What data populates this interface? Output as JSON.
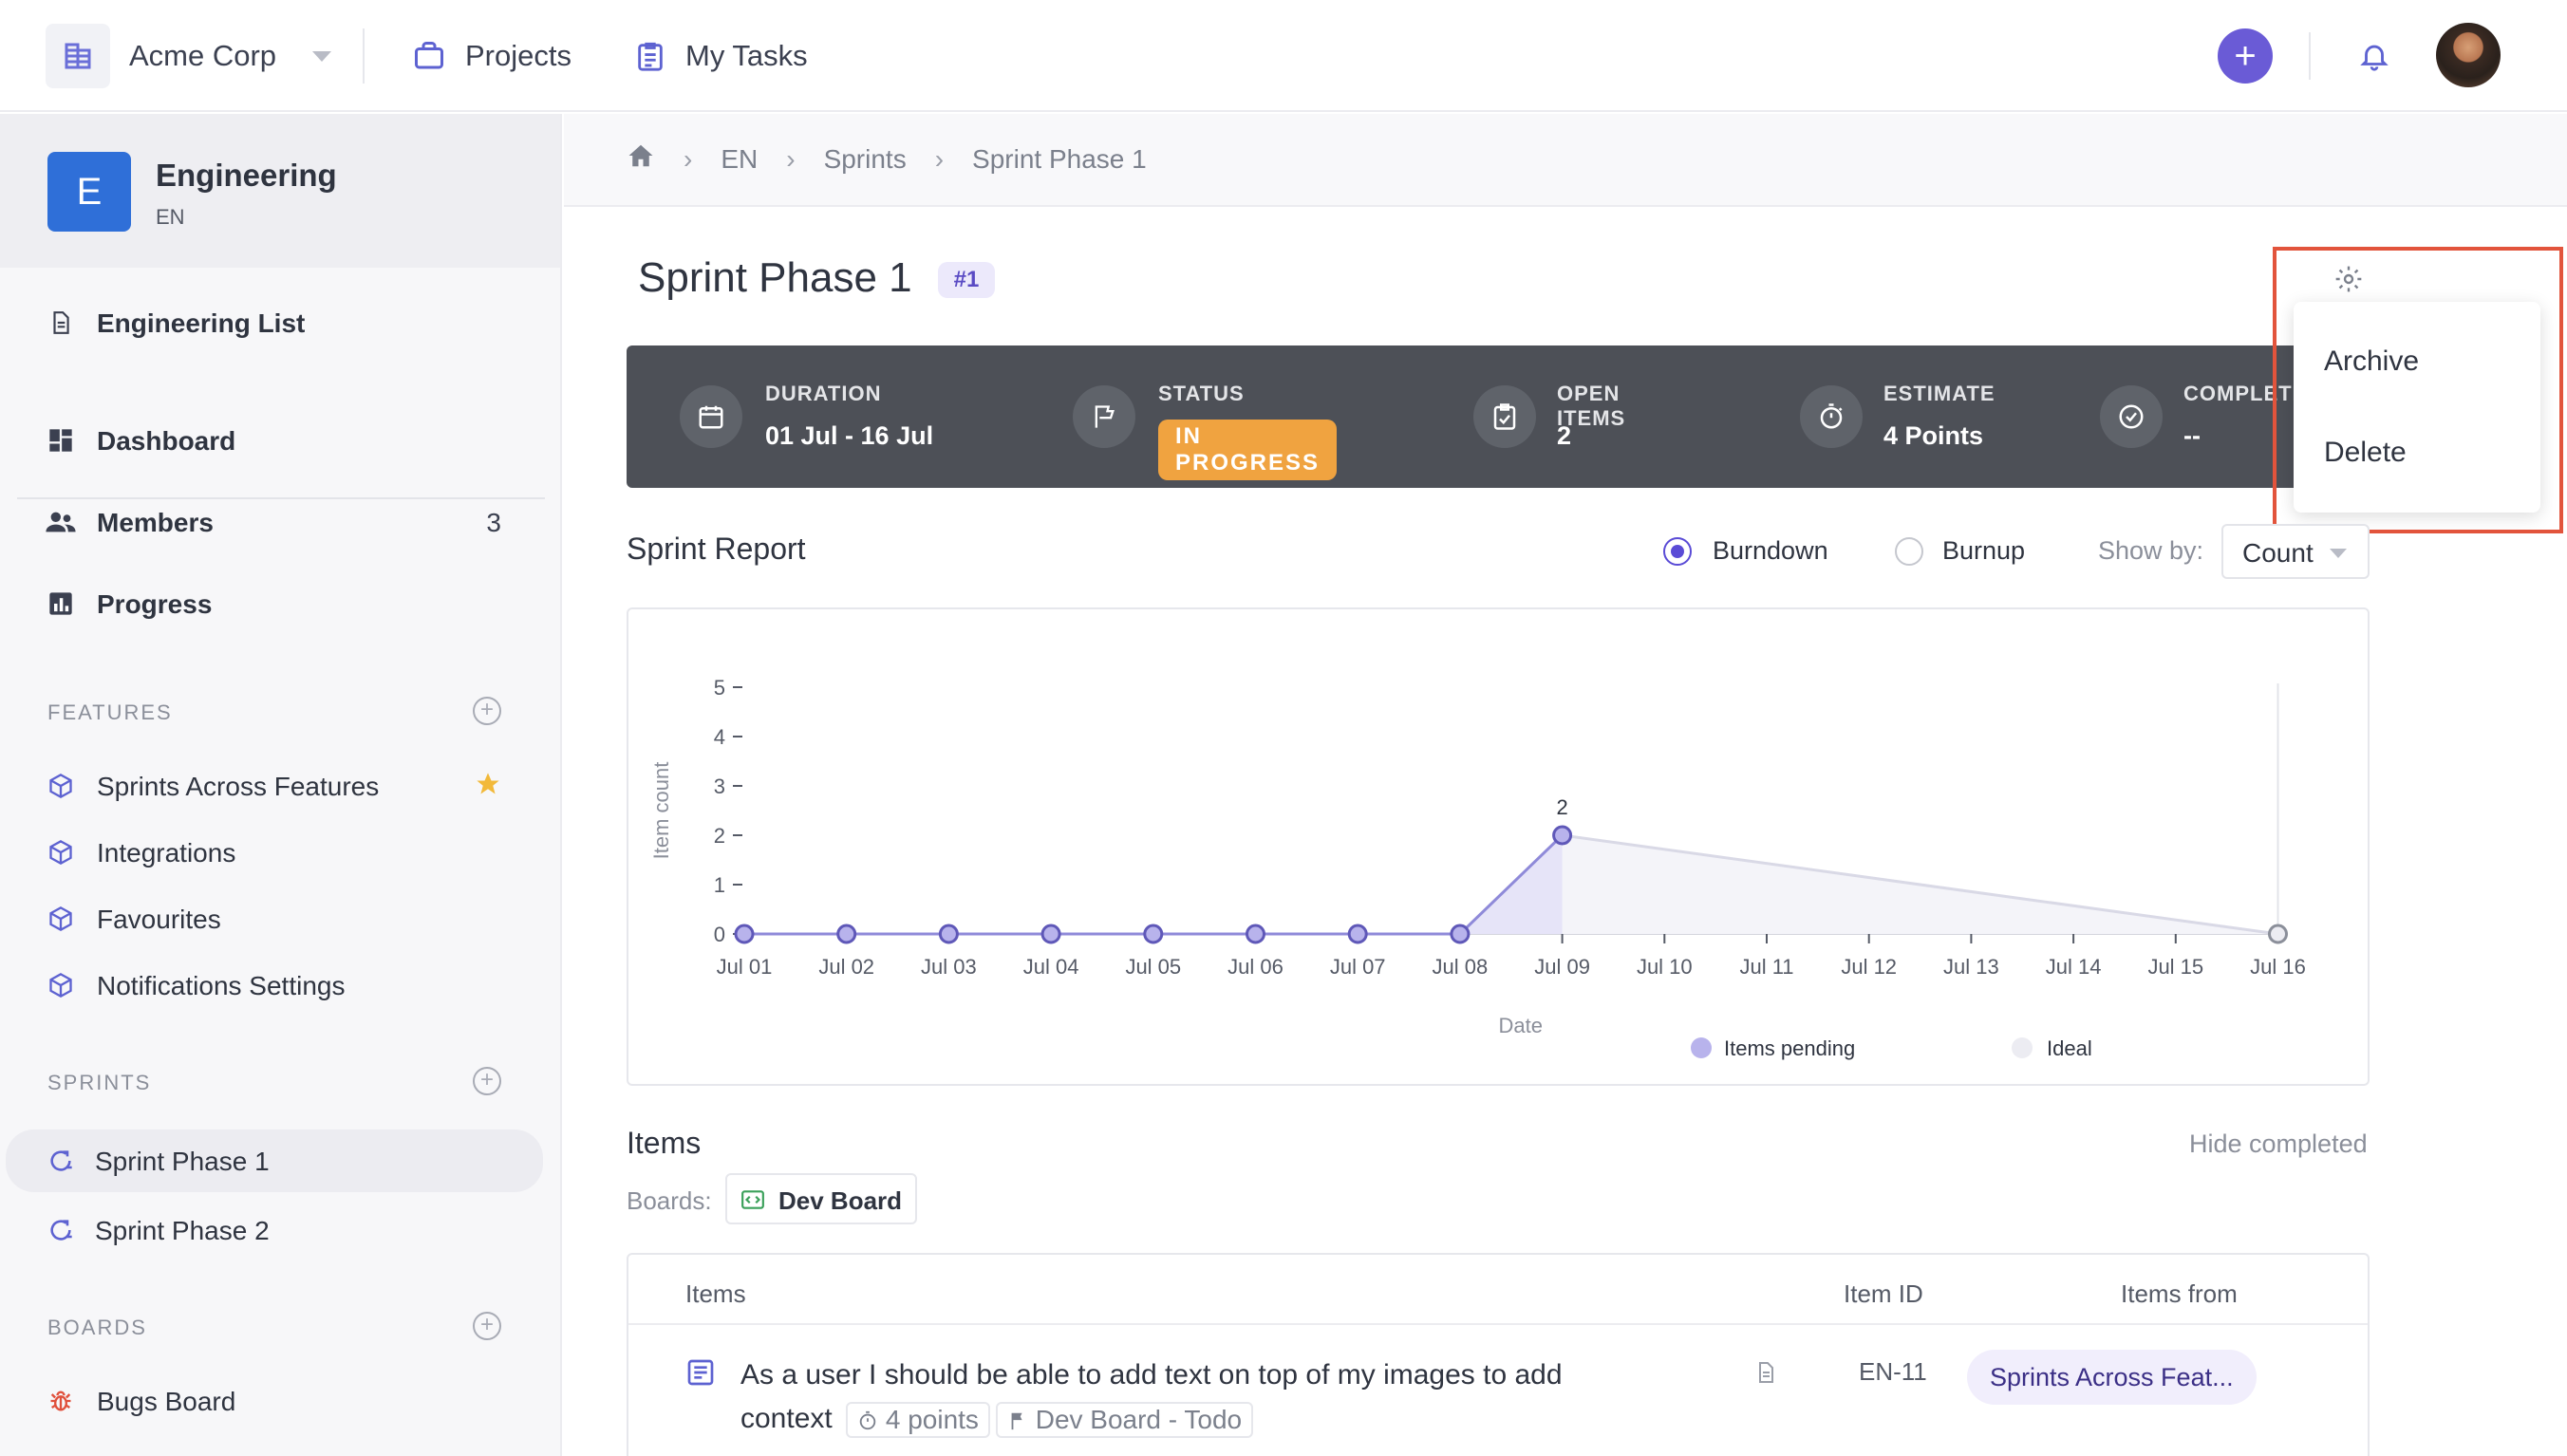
{
  "topbar": {
    "org_name": "Acme Corp",
    "nav": [
      {
        "label": "Projects",
        "icon": "briefcase-icon"
      },
      {
        "label": "My Tasks",
        "icon": "clipboard-icon"
      }
    ],
    "add_symbol": "+"
  },
  "sidebar": {
    "project": {
      "initial": "E",
      "name": "Engineering",
      "key": "EN",
      "color": "#2f6fd8"
    },
    "list_link": "Engineering List",
    "nav": [
      {
        "label": "Dashboard",
        "icon": "dashboard-icon",
        "count": ""
      },
      {
        "label": "Members",
        "icon": "members-icon",
        "count": "3"
      },
      {
        "label": "Progress",
        "icon": "progress-chart-icon",
        "count": ""
      }
    ],
    "features_title": "FEATURES",
    "features": [
      {
        "label": "Sprints Across Features",
        "starred": true
      },
      {
        "label": "Integrations",
        "starred": false
      },
      {
        "label": "Favourites",
        "starred": false
      },
      {
        "label": "Notifications Settings",
        "starred": false
      }
    ],
    "sprints_title": "SPRINTS",
    "sprints": [
      {
        "label": "Sprint Phase 1",
        "active": true
      },
      {
        "label": "Sprint Phase 2",
        "active": false
      }
    ],
    "boards_title": "BOARDS",
    "boards": [
      {
        "label": "Bugs Board"
      }
    ]
  },
  "breadcrumb": [
    "EN",
    "Sprints",
    "Sprint Phase 1"
  ],
  "page": {
    "title": "Sprint Phase 1",
    "badge": "#1"
  },
  "stats": [
    {
      "label": "DURATION",
      "value": "01 Jul - 16 Jul",
      "icon": "calendar-icon"
    },
    {
      "label": "STATUS",
      "value": "IN PROGRESS",
      "icon": "flag-icon",
      "status_color": "#f0a340"
    },
    {
      "label": "OPEN ITEMS",
      "value": "2",
      "icon": "checklist-icon"
    },
    {
      "label": "ESTIMATE",
      "value": "4 Points",
      "icon": "stopwatch-icon"
    },
    {
      "label": "COMPLETE",
      "value": "--",
      "icon": "check-circle-icon"
    }
  ],
  "menu": {
    "items": [
      "Archive",
      "Delete"
    ],
    "highlight_color": "#e2543c"
  },
  "report": {
    "title": "Sprint Report",
    "modes": [
      {
        "label": "Burndown",
        "selected": true
      },
      {
        "label": "Burnup",
        "selected": false
      }
    ],
    "show_by_label": "Show by:",
    "show_by_value": "Count"
  },
  "chart_data": {
    "type": "line",
    "ylabel": "Item count",
    "xlabel": "Date",
    "x": [
      "Jul 01",
      "Jul 02",
      "Jul 03",
      "Jul 04",
      "Jul 05",
      "Jul 06",
      "Jul 07",
      "Jul 08",
      "Jul 09",
      "Jul 10",
      "Jul 11",
      "Jul 12",
      "Jul 13",
      "Jul 14",
      "Jul 15",
      "Jul 16"
    ],
    "yticks": [
      0,
      1,
      2,
      3,
      4,
      5
    ],
    "ylim": [
      0,
      5
    ],
    "series": [
      {
        "name": "Items pending",
        "color": "#8f8ad9",
        "values": [
          0,
          0,
          0,
          0,
          0,
          0,
          0,
          0,
          2,
          null,
          null,
          null,
          null,
          null,
          null,
          null
        ]
      },
      {
        "name": "Ideal",
        "color": "#d9d9e6",
        "values": [
          null,
          null,
          null,
          null,
          null,
          null,
          null,
          null,
          2,
          null,
          null,
          null,
          null,
          null,
          null,
          0
        ]
      }
    ],
    "data_labels": [
      {
        "x": "Jul 09",
        "value": "2"
      }
    ],
    "legend_position": "bottom",
    "grid": false
  },
  "items": {
    "title": "Items",
    "hide_completed": "Hide completed",
    "boards_label": "Boards:",
    "board": "Dev Board",
    "columns": [
      "Items",
      "Item ID",
      "Items from"
    ],
    "rows": [
      {
        "title": "As a user I should be able to add text on top of my images to add context",
        "points": "4 points",
        "board_status": "Dev Board - Todo",
        "id": "EN-11",
        "from": "Sprints Across Feat..."
      }
    ]
  }
}
